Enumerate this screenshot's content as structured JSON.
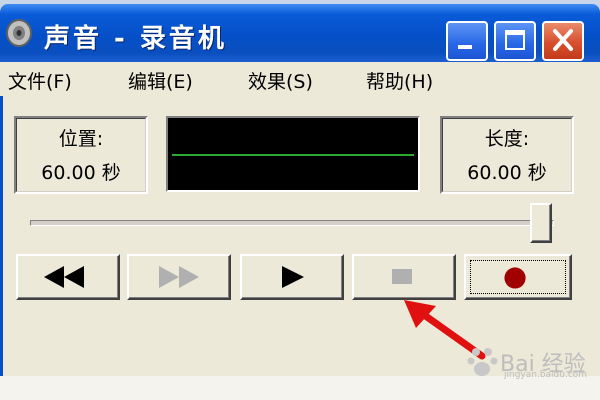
{
  "window": {
    "title": "声音 - 录音机"
  },
  "menu": {
    "items": [
      {
        "label": "文件(F)"
      },
      {
        "label": "编辑(E)"
      },
      {
        "label": "效果(S)"
      },
      {
        "label": "帮助(H)"
      }
    ]
  },
  "position": {
    "label": "位置:",
    "value": "60.00 秒"
  },
  "length": {
    "label": "长度:",
    "value": "60.00 秒"
  },
  "slider": {
    "fraction": 1.0
  },
  "transport": {
    "buttons": [
      {
        "icon": "seek-start-icon",
        "enabled": true
      },
      {
        "icon": "seek-end-icon",
        "enabled": false
      },
      {
        "icon": "play-icon",
        "enabled": true
      },
      {
        "icon": "stop-icon",
        "enabled": false
      },
      {
        "icon": "record-icon",
        "enabled": true
      }
    ]
  },
  "colors": {
    "titlebar": "#0550c8",
    "waveform_bg": "#000000",
    "waveform_line": "#2ea82e",
    "record_dot": "#a00000",
    "annotation_arrow": "#e01010"
  },
  "watermark": {
    "text": "Bai 经验",
    "sub": "jingyan.baidu.com"
  }
}
